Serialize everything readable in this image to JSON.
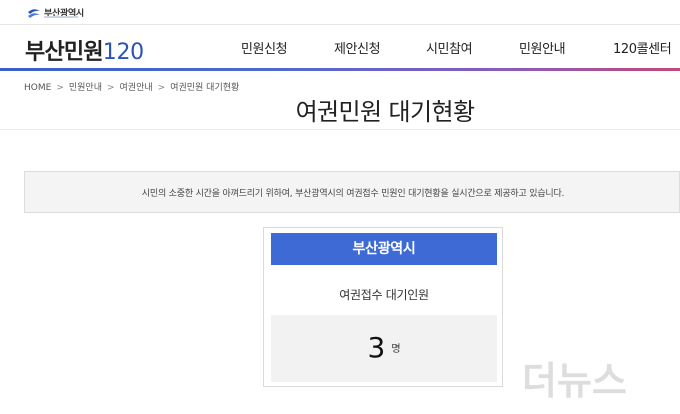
{
  "header": {
    "logo_text": "부산광역시",
    "site_title": "부산민원",
    "site_title_number": "120",
    "nav": [
      "민원신청",
      "제안신청",
      "시민참여",
      "민원안내",
      "120콜센터"
    ]
  },
  "breadcrumb": [
    "HOME",
    "민원안내",
    "여권안내",
    "여권민원 대기현황"
  ],
  "page_title": "여권민원 대기현황",
  "notice": "시민의 소중한 시간을 아껴드리기 위하여, 부산광역시의 여권접수 민원인 대기현황을 실시간으로 제공하고 있습니다.",
  "card": {
    "header": "부산광역시",
    "subtitle": "여권접수 대기인원",
    "count": "3",
    "unit": "명"
  },
  "watermark": "더뉴스",
  "colors": {
    "accent": "#3e6ad6",
    "title_number": "#2b53b5",
    "gradient_end": "#c04a7a"
  }
}
